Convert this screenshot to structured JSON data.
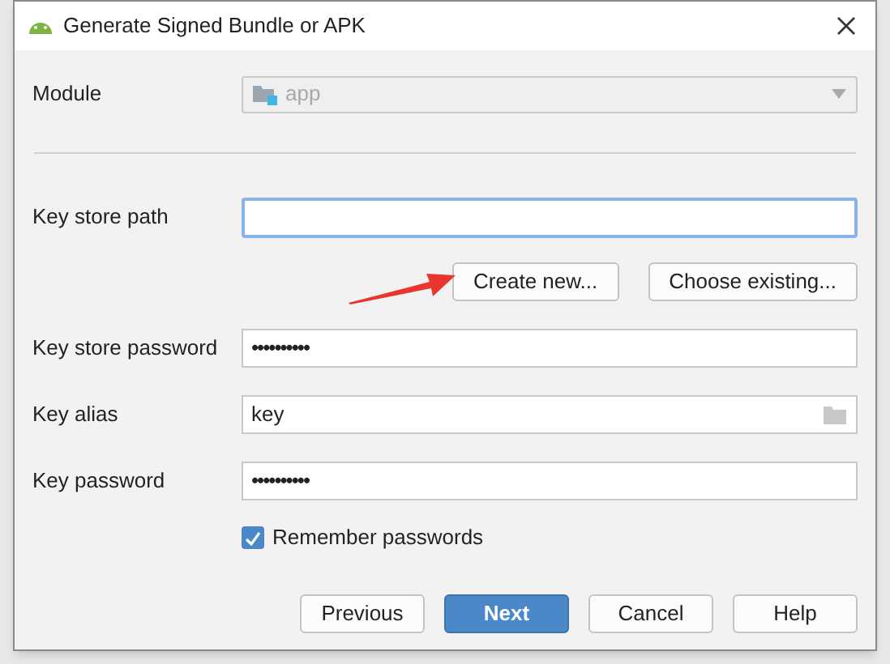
{
  "window": {
    "title": "Generate Signed Bundle or APK"
  },
  "module": {
    "label": "Module",
    "value": "app",
    "disabled": true
  },
  "key_store_path": {
    "label": "Key store path",
    "focused": true
  },
  "key_store_buttons": [
    {
      "label": "Create new..."
    },
    {
      "label": "Choose existing..."
    }
  ],
  "fields": [
    {
      "kind": "password",
      "label": "Key store password",
      "value": "••••••••••"
    },
    {
      "kind": "browse",
      "label": "Key alias",
      "value": "key"
    },
    {
      "kind": "password",
      "label": "Key password",
      "value": "••••••••••"
    }
  ],
  "remember_passwords": {
    "label": "Remember passwords",
    "checked": true
  },
  "buttons": [
    {
      "label": "Previous",
      "primary": false
    },
    {
      "label": "Next",
      "primary": true
    },
    {
      "label": "Cancel",
      "primary": false
    },
    {
      "label": "Help",
      "primary": false
    }
  ]
}
